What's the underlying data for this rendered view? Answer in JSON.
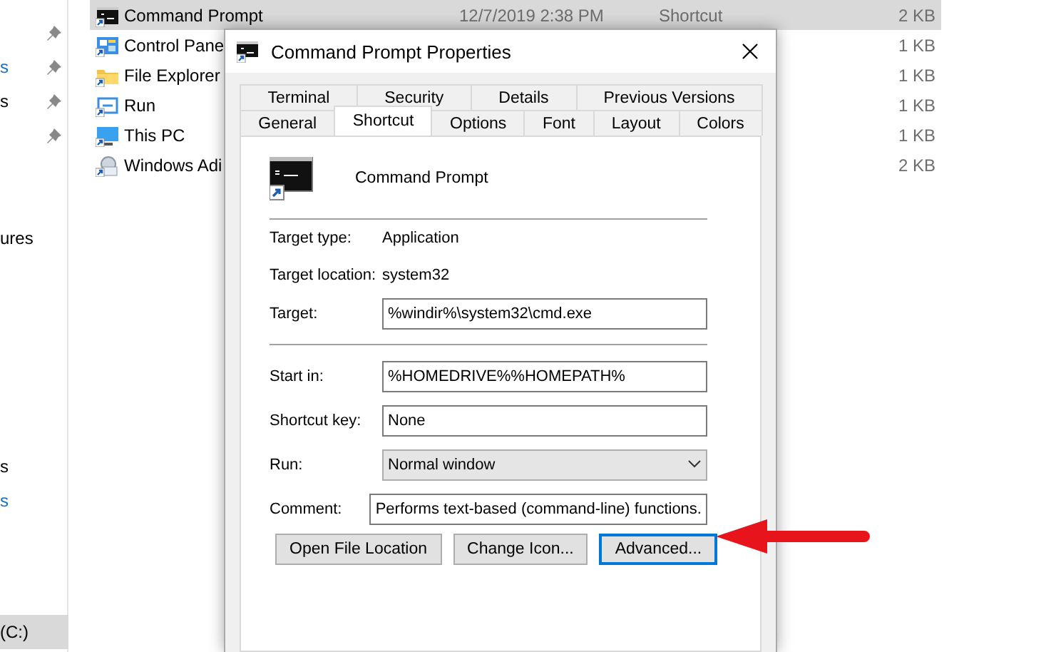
{
  "explorer": {
    "nav_groups": [
      [
        {
          "pinned": true
        },
        {
          "label": "s",
          "pinned": true,
          "color": "#1a6fc4"
        },
        {
          "label": "s",
          "pinned": true,
          "color": "#000000"
        },
        {
          "pinned": true
        }
      ],
      [
        {
          "label": "ures",
          "color": "#000000"
        }
      ],
      [
        {
          "label": "s",
          "color": "#000000"
        },
        {
          "label": "s",
          "color": "#1a6fc4"
        }
      ],
      [
        {
          "label": "(C:)",
          "color": "#000000",
          "selected": true
        }
      ]
    ],
    "files": [
      {
        "name": "Command Prompt",
        "date": "12/7/2019 2:38 PM",
        "type": "Shortcut",
        "size": "2 KB",
        "selected": true
      },
      {
        "name": "Control Pane",
        "size": "1 KB",
        "selected": false
      },
      {
        "name": "File Explorer",
        "size": "1 KB",
        "selected": false
      },
      {
        "name": "Run",
        "size": "1 KB",
        "selected": false
      },
      {
        "name": "This PC",
        "size": "1 KB",
        "selected": false
      },
      {
        "name": "Windows Adi",
        "size": "2 KB",
        "selected": false
      }
    ]
  },
  "dialog": {
    "title": "Command Prompt Properties",
    "tab_rows": [
      [
        {
          "label": "Terminal",
          "selected": false
        },
        {
          "label": "Security",
          "selected": false
        },
        {
          "label": "Details",
          "selected": false
        },
        {
          "label": "Previous Versions",
          "selected": false
        }
      ],
      [
        {
          "label": "General",
          "selected": false
        },
        {
          "label": "Shortcut",
          "selected": true
        },
        {
          "label": "Options",
          "selected": false
        },
        {
          "label": "Font",
          "selected": false
        },
        {
          "label": "Layout",
          "selected": false
        },
        {
          "label": "Colors",
          "selected": false
        }
      ]
    ],
    "app_name": "Command Prompt",
    "info": [
      {
        "label": "Target type:",
        "value": "Application"
      },
      {
        "label": "Target location:",
        "value": "system32"
      }
    ],
    "target": {
      "label": "Target:",
      "value": "%windir%\\system32\\cmd.exe"
    },
    "fields": [
      {
        "kind": "text",
        "label": "Start in:",
        "value": "%HOMEDRIVE%%HOMEPATH%"
      },
      {
        "kind": "text",
        "label": "Shortcut key:",
        "value": "None"
      },
      {
        "kind": "dropdown",
        "label": "Run:",
        "value": "Normal window"
      },
      {
        "kind": "text",
        "label": "Comment:",
        "value": "Performs text-based (command-line) functions."
      }
    ],
    "buttons": [
      {
        "label": "Open File Location",
        "focused": false
      },
      {
        "label": "Change Icon...",
        "focused": false
      },
      {
        "label": "Advanced...",
        "focused": true
      }
    ]
  }
}
